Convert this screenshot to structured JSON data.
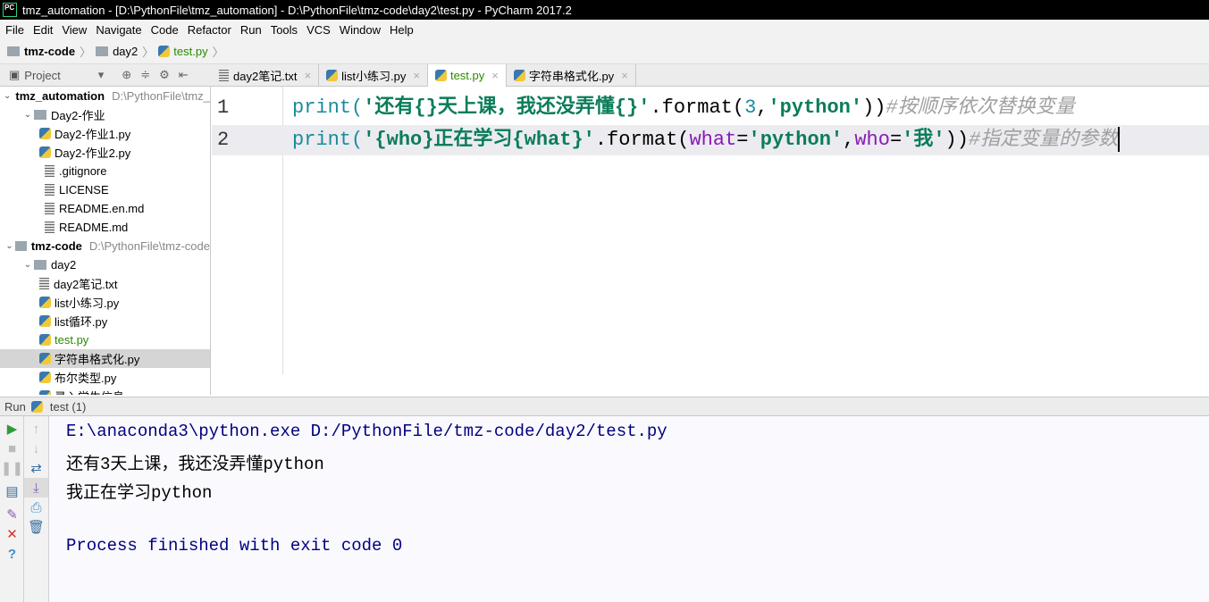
{
  "window": {
    "title": "tmz_automation - [D:\\PythonFile\\tmz_automation] - D:\\PythonFile\\tmz-code\\day2\\test.py - PyCharm 2017.2",
    "logo": "PC"
  },
  "menu": [
    "File",
    "Edit",
    "View",
    "Navigate",
    "Code",
    "Refactor",
    "Run",
    "Tools",
    "VCS",
    "Window",
    "Help"
  ],
  "breadcrumb": [
    "tmz-code",
    "day2",
    "test.py"
  ],
  "project_panel": {
    "label": "Project"
  },
  "tabs": [
    {
      "label": "day2笔记.txt"
    },
    {
      "label": "list小练习.py"
    },
    {
      "label": "test.py",
      "active": true
    },
    {
      "label": "字符串格式化.py"
    }
  ],
  "tree": [
    {
      "label": "tmz_automation",
      "path": "D:\\PythonFile\\tmz_automation",
      "level": 0,
      "type": "root"
    },
    {
      "label": "Day2-作业",
      "level": 1,
      "type": "folder"
    },
    {
      "label": "Day2-作业1.py",
      "level": 2,
      "type": "py"
    },
    {
      "label": "Day2-作业2.py",
      "level": 2,
      "type": "py"
    },
    {
      "label": ".gitignore",
      "level": 1,
      "type": "txt"
    },
    {
      "label": "LICENSE",
      "level": 1,
      "type": "txt"
    },
    {
      "label": "README.en.md",
      "level": 1,
      "type": "txt"
    },
    {
      "label": "README.md",
      "level": 1,
      "type": "txt"
    },
    {
      "label": "tmz-code",
      "path": "D:\\PythonFile\\tmz-code",
      "level": 0,
      "type": "root"
    },
    {
      "label": "day2",
      "level": 1,
      "type": "folder"
    },
    {
      "label": "day2笔记.txt",
      "level": 2,
      "type": "txt"
    },
    {
      "label": "list小练习.py",
      "level": 2,
      "type": "py"
    },
    {
      "label": "list循环.py",
      "level": 2,
      "type": "py"
    },
    {
      "label": "test.py",
      "level": 2,
      "type": "py"
    },
    {
      "label": "字符串格式化.py",
      "level": 2,
      "type": "py"
    },
    {
      "label": "布尔类型.py",
      "level": 2,
      "type": "py"
    },
    {
      "label": "录入学生信息.py",
      "level": 2,
      "type": "py"
    }
  ],
  "editor": {
    "lines": [
      {
        "n": "1",
        "parts": [
          [
            "kw",
            "print("
          ],
          [
            "str",
            "'还有{}天上课，我还没弄懂{}'"
          ],
          [
            "pl",
            ".format("
          ],
          [
            "kw",
            "3"
          ],
          [
            "pl",
            ","
          ],
          [
            "str",
            "'python'"
          ],
          [
            "pl",
            "))"
          ],
          [
            "cm",
            "#按顺序依次替换变量"
          ]
        ]
      },
      {
        "n": "2",
        "parts": [
          [
            "kw",
            "print("
          ],
          [
            "str",
            "'{who}正在学习{what}'"
          ],
          [
            "pl",
            ".format("
          ],
          [
            "arg",
            "what"
          ],
          [
            "pl",
            "="
          ],
          [
            "str",
            "'python'"
          ],
          [
            "pl",
            ","
          ],
          [
            "arg",
            "who"
          ],
          [
            "pl",
            "="
          ],
          [
            "str",
            "'我'"
          ],
          [
            "pl",
            "))"
          ],
          [
            "cm",
            "#指定变量的参数"
          ]
        ]
      }
    ]
  },
  "run": {
    "label": "Run",
    "config": "test (1)",
    "output": [
      {
        "text": "E:\\anaconda3\\python.exe D:/PythonFile/tmz-code/day2/test.py",
        "color": "#000080"
      },
      {
        "text": "还有3天上课，我还没弄懂python",
        "color": "#000000"
      },
      {
        "text": "我正在学习python",
        "color": "#000000"
      },
      {
        "text": "",
        "color": "#000000"
      },
      {
        "text": "Process finished with exit code 0",
        "color": "#000080"
      }
    ]
  }
}
